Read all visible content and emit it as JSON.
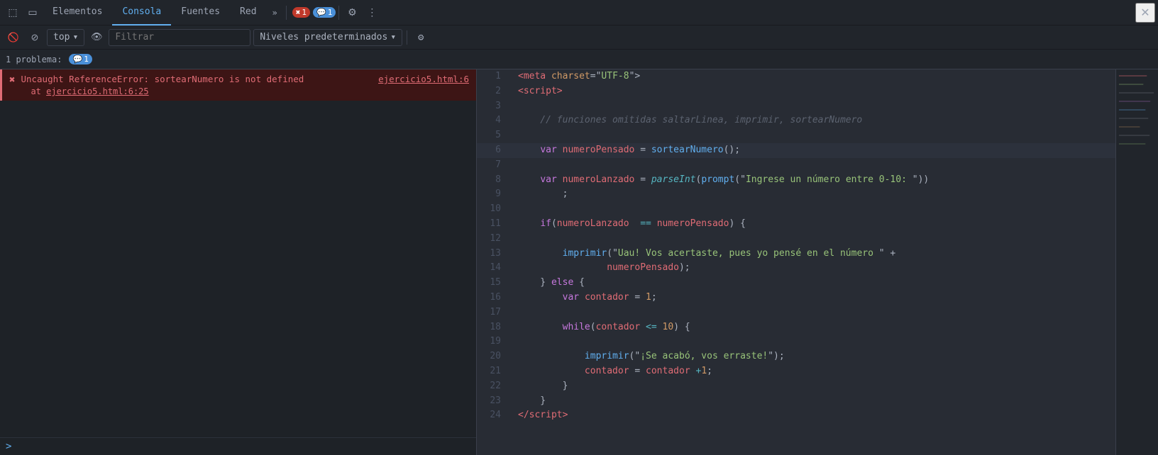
{
  "toolbar": {
    "tabs": [
      {
        "label": "Elementos",
        "active": false
      },
      {
        "label": "Consola",
        "active": true
      },
      {
        "label": "Fuentes",
        "active": false
      },
      {
        "label": "Red",
        "active": false
      },
      {
        "label": "»",
        "active": false
      }
    ],
    "error_badge": "1",
    "warning_badge": "1",
    "close_label": "×"
  },
  "console_toolbar": {
    "top_label": "top",
    "filter_placeholder": "Filtrar",
    "levels_label": "Niveles predeterminados"
  },
  "issues_bar": {
    "label": "1 problema:",
    "badge": "1"
  },
  "console": {
    "error": {
      "main": "Uncaught ReferenceError: sortearNumero is not defined",
      "link": "ejercicio5.html:6",
      "at_text": "    at ",
      "at_link": "ejercicio5.html:6:25"
    },
    "prompt": ">"
  },
  "code": {
    "lines": [
      {
        "num": 1,
        "tokens": [
          {
            "t": "tag",
            "v": "<meta"
          },
          {
            "t": "punct",
            "v": " "
          },
          {
            "t": "attr",
            "v": "charset"
          },
          {
            "t": "punct",
            "v": "=\""
          },
          {
            "t": "val",
            "v": "UTF-8"
          },
          {
            "t": "punct",
            "v": "\">"
          }
        ]
      },
      {
        "num": 2,
        "tokens": [
          {
            "t": "tag",
            "v": "<script"
          },
          {
            "t": "punct",
            "v": ">"
          }
        ]
      },
      {
        "num": 3,
        "tokens": []
      },
      {
        "num": 4,
        "tokens": [
          {
            "t": "comment",
            "v": "    // funciones omitidas saltarLinea, imprimir, sortearNumero"
          }
        ]
      },
      {
        "num": 5,
        "tokens": []
      },
      {
        "num": 6,
        "tokens": [
          {
            "t": "punct",
            "v": "    "
          },
          {
            "t": "kw",
            "v": "var"
          },
          {
            "t": "punct",
            "v": " "
          },
          {
            "t": "var-name",
            "v": "numeroPensado"
          },
          {
            "t": "punct",
            "v": " = "
          },
          {
            "t": "fn",
            "v": "sortearNumero"
          },
          {
            "t": "punct",
            "v": "();"
          }
        ],
        "highlight": true
      },
      {
        "num": 7,
        "tokens": []
      },
      {
        "num": 8,
        "tokens": [
          {
            "t": "punct",
            "v": "    "
          },
          {
            "t": "kw",
            "v": "var"
          },
          {
            "t": "punct",
            "v": " "
          },
          {
            "t": "var-name",
            "v": "numeroLanzado"
          },
          {
            "t": "punct",
            "v": " = "
          },
          {
            "t": "builtin",
            "v": "parseInt"
          },
          {
            "t": "punct",
            "v": "("
          },
          {
            "t": "fn",
            "v": "prompt"
          },
          {
            "t": "punct",
            "v": "(\""
          },
          {
            "t": "str",
            "v": "Ingrese un número entre 0-10: "
          },
          {
            "t": "punct",
            "v": "\"))"
          }
        ]
      },
      {
        "num": 9,
        "tokens": [
          {
            "t": "punct",
            "v": "        ;"
          }
        ]
      },
      {
        "num": 10,
        "tokens": []
      },
      {
        "num": 11,
        "tokens": [
          {
            "t": "punct",
            "v": "    "
          },
          {
            "t": "kw",
            "v": "if"
          },
          {
            "t": "punct",
            "v": "("
          },
          {
            "t": "var-name",
            "v": "numeroLanzado"
          },
          {
            "t": "punct",
            "v": "  "
          },
          {
            "t": "op",
            "v": "=="
          },
          {
            "t": "punct",
            "v": " "
          },
          {
            "t": "var-name",
            "v": "numeroPensado"
          },
          {
            "t": "punct",
            "v": ") {"
          }
        ]
      },
      {
        "num": 12,
        "tokens": []
      },
      {
        "num": 13,
        "tokens": [
          {
            "t": "punct",
            "v": "        "
          },
          {
            "t": "fn",
            "v": "imprimir"
          },
          {
            "t": "punct",
            "v": "(\""
          },
          {
            "t": "str",
            "v": "Uau! Vos acertaste, pues yo pensé en el número "
          },
          {
            "t": "punct",
            "v": "\" +"
          },
          {
            "t": "punct",
            "v": ""
          }
        ]
      },
      {
        "num": 14,
        "tokens": [
          {
            "t": "punct",
            "v": "                "
          },
          {
            "t": "var-name",
            "v": "numeroPensado"
          },
          {
            "t": "punct",
            "v": ");"
          }
        ]
      },
      {
        "num": 15,
        "tokens": [
          {
            "t": "punct",
            "v": "    } "
          },
          {
            "t": "kw",
            "v": "else"
          },
          {
            "t": "punct",
            "v": " {"
          }
        ]
      },
      {
        "num": 16,
        "tokens": [
          {
            "t": "punct",
            "v": "        "
          },
          {
            "t": "kw",
            "v": "var"
          },
          {
            "t": "punct",
            "v": " "
          },
          {
            "t": "var-name",
            "v": "contador"
          },
          {
            "t": "punct",
            "v": " = "
          },
          {
            "t": "num",
            "v": "1"
          },
          {
            "t": "punct",
            "v": ";"
          }
        ]
      },
      {
        "num": 17,
        "tokens": []
      },
      {
        "num": 18,
        "tokens": [
          {
            "t": "punct",
            "v": "        "
          },
          {
            "t": "kw",
            "v": "while"
          },
          {
            "t": "punct",
            "v": "("
          },
          {
            "t": "var-name",
            "v": "contador"
          },
          {
            "t": "punct",
            "v": " "
          },
          {
            "t": "op",
            "v": "<="
          },
          {
            "t": "punct",
            "v": " "
          },
          {
            "t": "num",
            "v": "10"
          },
          {
            "t": "punct",
            "v": ") {"
          }
        ]
      },
      {
        "num": 19,
        "tokens": []
      },
      {
        "num": 20,
        "tokens": [
          {
            "t": "punct",
            "v": "            "
          },
          {
            "t": "fn",
            "v": "imprimir"
          },
          {
            "t": "punct",
            "v": "(\""
          },
          {
            "t": "str",
            "v": "¡Se acabó, vos erraste!"
          },
          {
            "t": "punct",
            "v": "\");"
          }
        ]
      },
      {
        "num": 21,
        "tokens": [
          {
            "t": "punct",
            "v": "            "
          },
          {
            "t": "var-name",
            "v": "contador"
          },
          {
            "t": "punct",
            "v": " = "
          },
          {
            "t": "var-name",
            "v": "contador"
          },
          {
            "t": "punct",
            "v": " "
          },
          {
            "t": "op",
            "v": "+"
          },
          {
            "t": "num",
            "v": "1"
          },
          {
            "t": "punct",
            "v": ";"
          }
        ]
      },
      {
        "num": 22,
        "tokens": [
          {
            "t": "punct",
            "v": "        }"
          }
        ]
      },
      {
        "num": 23,
        "tokens": [
          {
            "t": "punct",
            "v": "    }"
          }
        ]
      },
      {
        "num": 24,
        "tokens": [
          {
            "t": "tag",
            "v": "</"
          },
          {
            "t": "tag",
            "v": "script"
          },
          {
            "t": "tag",
            "v": ">"
          }
        ]
      }
    ]
  }
}
